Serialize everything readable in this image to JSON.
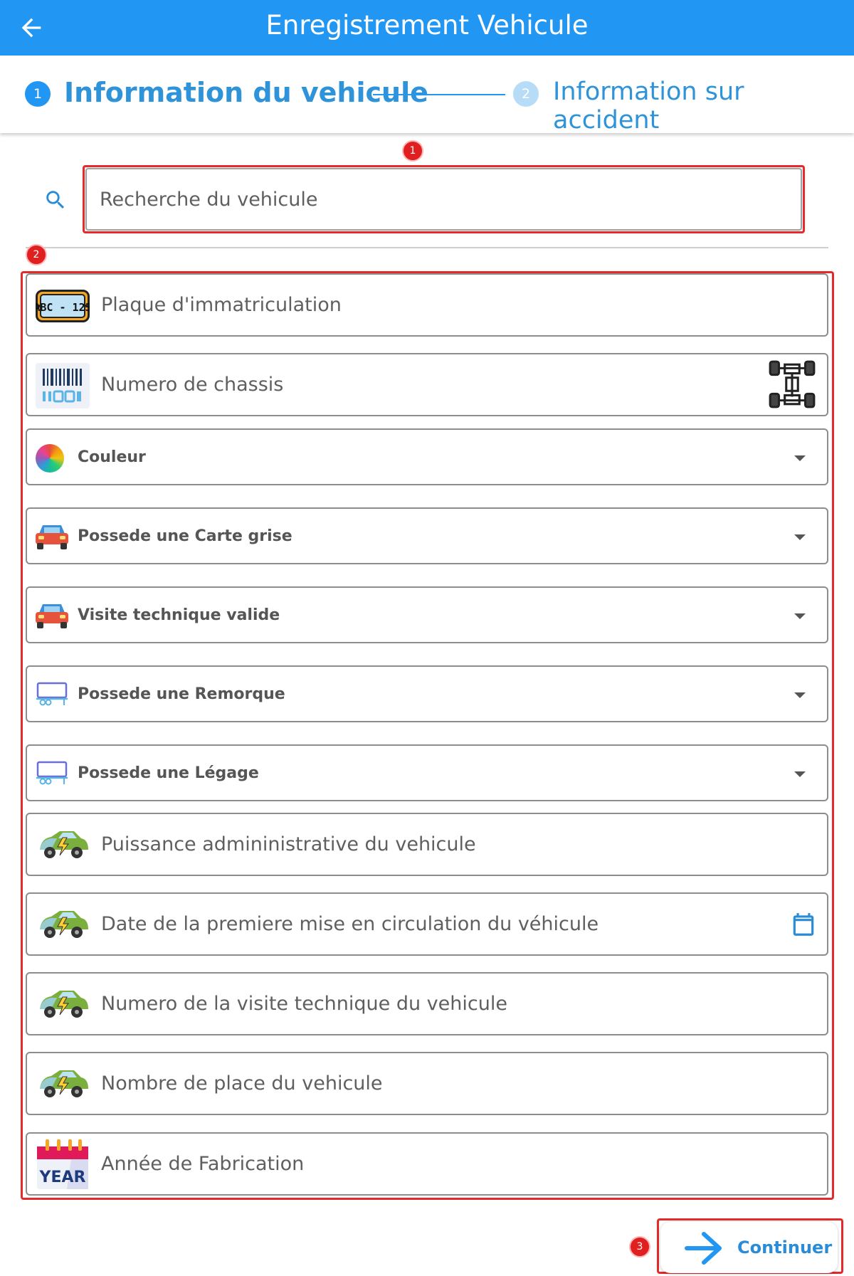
{
  "appbar": {
    "title": "Enregistrement Vehicule",
    "back_icon": "arrow-left-icon"
  },
  "stepper": {
    "step1": {
      "number": "1",
      "label": "Information du vehicule"
    },
    "step2": {
      "number": "2",
      "label": "Information sur accident"
    }
  },
  "markers": {
    "m1": "1",
    "m2": "2",
    "m3": "3"
  },
  "search": {
    "placeholder": "Recherche du vehicule",
    "icon": "search-icon"
  },
  "fields": {
    "plaque": "Plaque d'immatriculation",
    "chassis": "Numero de chassis",
    "couleur": "Couleur",
    "carte_grise": "Possede une Carte grise",
    "visite": "Visite technique valide",
    "remorque": "Possede une Remorque",
    "legage": "Possede une Légage",
    "puissance": "Puissance admininistrative du vehicule",
    "date_circulation": "Date de la premiere mise en circulation du véhicule",
    "num_visite": "Numero de la visite technique du vehicule",
    "nombre_place": "Nombre de place du vehicule",
    "annee": "Année de Fabrication"
  },
  "icon_text": {
    "plate": "ABC - 123",
    "year": "YEAR"
  },
  "continue": {
    "label": "Continuer"
  },
  "colors": {
    "primary": "#2196f3",
    "annotation": "#e02020",
    "step_text": "#2f93d9"
  }
}
